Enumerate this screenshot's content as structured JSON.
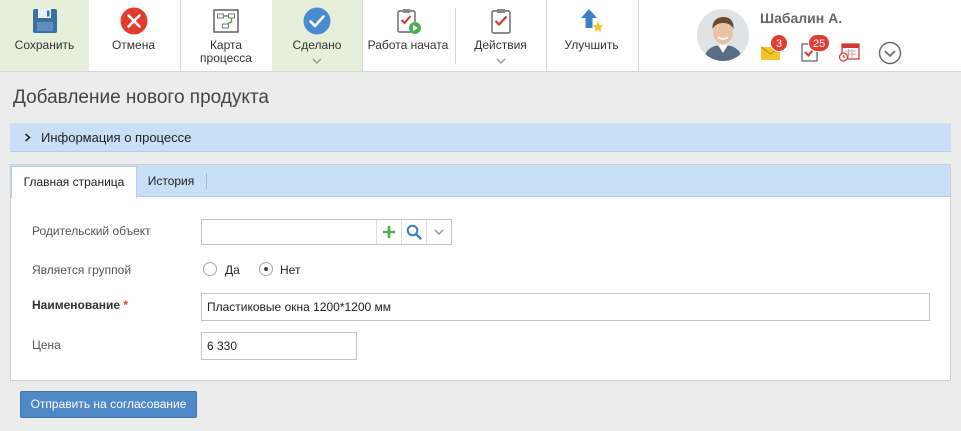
{
  "toolbar": {
    "save": "Сохранить",
    "cancel": "Отмена",
    "process_map": "Карта\nпроцесса",
    "done": "Сделано",
    "work_started": "Работа начата",
    "actions": "Действия",
    "improve": "Улучшить"
  },
  "user": {
    "name": "Шабалин А.",
    "messages_count": "3",
    "tasks_count": "25"
  },
  "page": {
    "title": "Добавление нового продукта",
    "process_info": "Информация о процессе"
  },
  "tabs": [
    {
      "label": "Главная страница"
    },
    {
      "label": "История"
    }
  ],
  "form": {
    "parent_label": "Родительский объект",
    "parent_value": "",
    "is_group_label": "Является группой",
    "option_yes": "Да",
    "option_no": "Нет",
    "is_group_selected": "Нет",
    "name_label": "Наименование",
    "required_mark": "*",
    "name_value": "Пластиковые окна 1200*1200 мм",
    "price_label": "Цена",
    "price_value": "6 330"
  },
  "submit_label": "Отправить на согласование",
  "colors": {
    "accent_blue": "#4f88c6",
    "header_blue": "#c9dff7",
    "badge_red": "#e23c31",
    "done_green": "#e6efd9"
  },
  "icons": [
    "floppy-disk-icon",
    "cancel-x-icon",
    "process-map-icon",
    "checkmark-circle-icon",
    "clipboard-play-icon",
    "clipboard-check-icon",
    "improve-arrow-icon",
    "envelope-icon",
    "task-check-icon",
    "calendar-icon",
    "chevron-circle-down-icon",
    "plus-icon",
    "magnifier-icon",
    "chevron-down-icon",
    "chevron-right-icon"
  ]
}
